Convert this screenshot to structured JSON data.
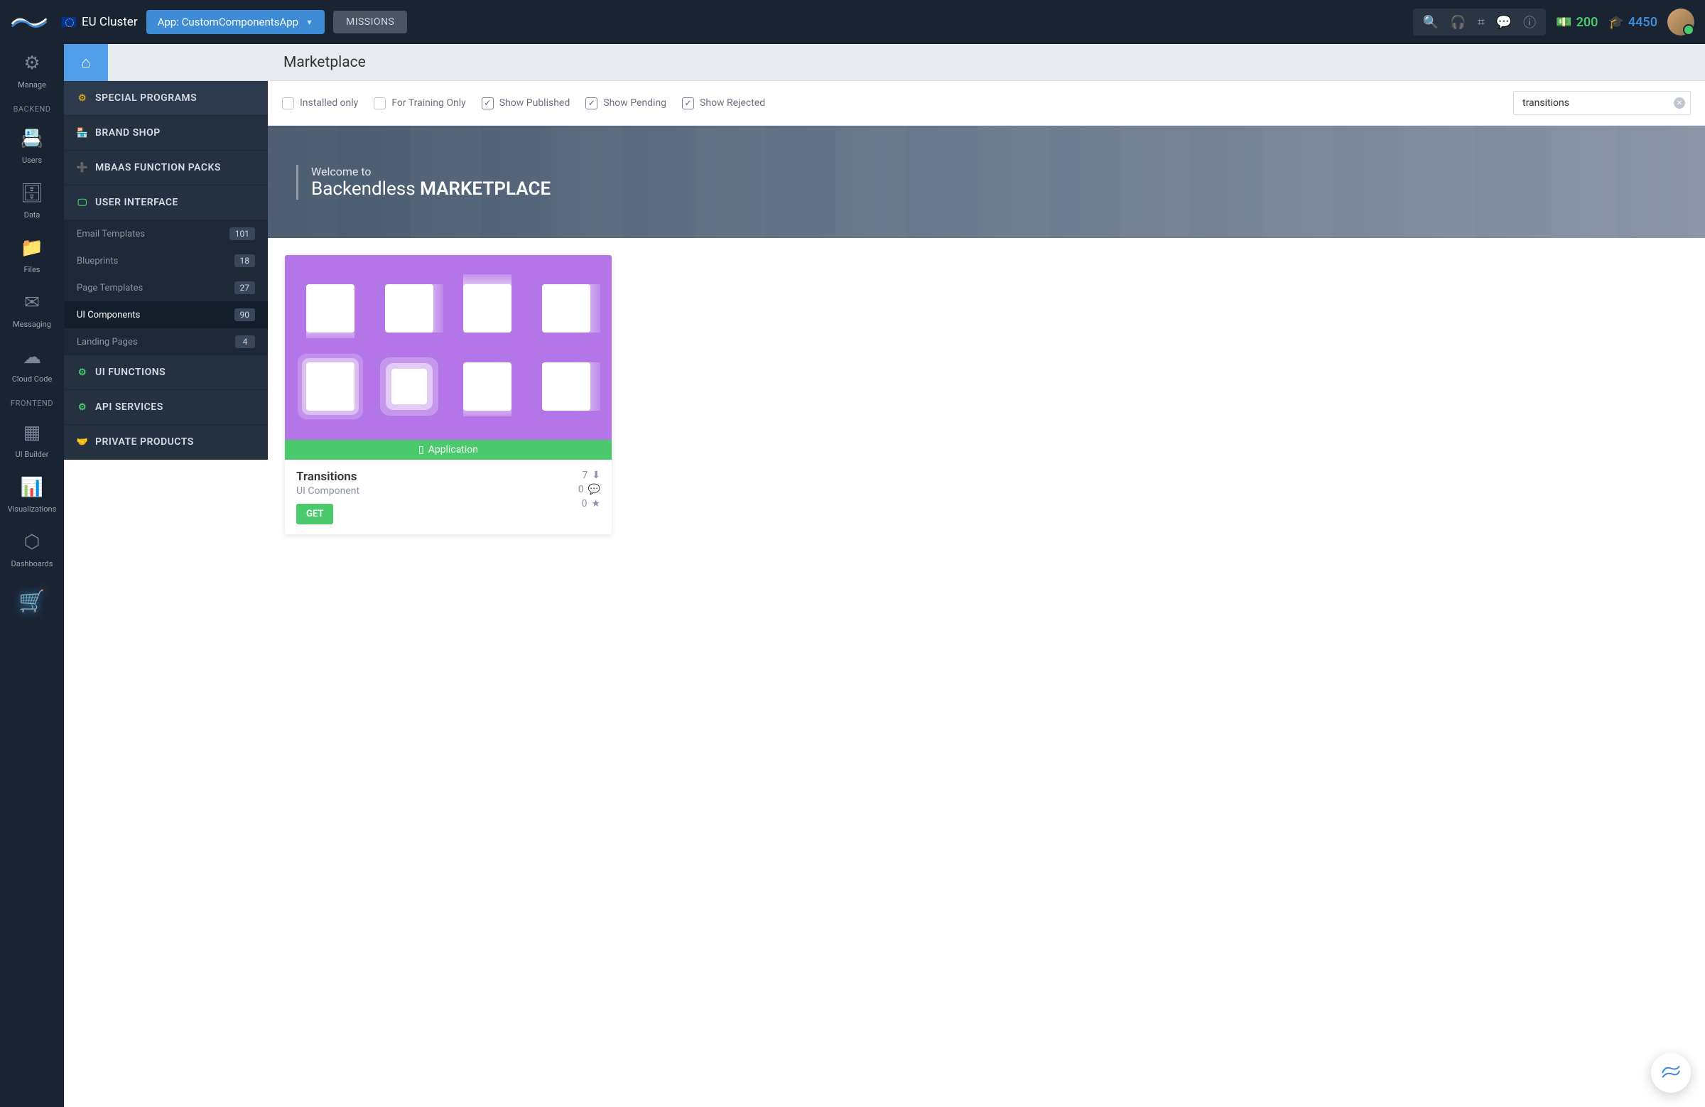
{
  "header": {
    "cluster": "EU Cluster",
    "app_label": "App: CustomComponentsApp",
    "missions": "MISSIONS",
    "credits_green": "200",
    "credits_blue": "4450"
  },
  "rail": {
    "manage": "Manage",
    "backend_section": "BACKEND",
    "users": "Users",
    "data": "Data",
    "files": "Files",
    "messaging": "Messaging",
    "cloud_code": "Cloud Code",
    "frontend_section": "FRONTEND",
    "ui_builder": "UI Builder",
    "visualizations": "Visualizations",
    "dashboards": "Dashboards"
  },
  "page": {
    "title": "Marketplace"
  },
  "categories": {
    "special_programs": "SPECIAL PROGRAMS",
    "brand_shop": "BRAND SHOP",
    "mbaas": "MBAAS FUNCTION PACKS",
    "user_interface": "USER INTERFACE",
    "ui_functions": "UI FUNCTIONS",
    "api_services": "API SERVICES",
    "private_products": "PRIVATE PRODUCTS",
    "subs": {
      "email_templates": {
        "label": "Email Templates",
        "count": "101"
      },
      "blueprints": {
        "label": "Blueprints",
        "count": "18"
      },
      "page_templates": {
        "label": "Page Templates",
        "count": "27"
      },
      "ui_components": {
        "label": "UI Components",
        "count": "90"
      },
      "landing_pages": {
        "label": "Landing Pages",
        "count": "4"
      }
    }
  },
  "filters": {
    "installed_only": "Installed only",
    "training_only": "For Training Only",
    "show_published": "Show Published",
    "show_pending": "Show Pending",
    "show_rejected": "Show Rejected",
    "search_value": "transitions"
  },
  "hero": {
    "welcome": "Welcome to",
    "brand": "Backendless",
    "title": "MARKETPLACE"
  },
  "card": {
    "tag": "Application",
    "title": "Transitions",
    "subtitle": "UI Component",
    "get": "GET",
    "downloads": "7",
    "comments": "0",
    "stars": "0"
  }
}
